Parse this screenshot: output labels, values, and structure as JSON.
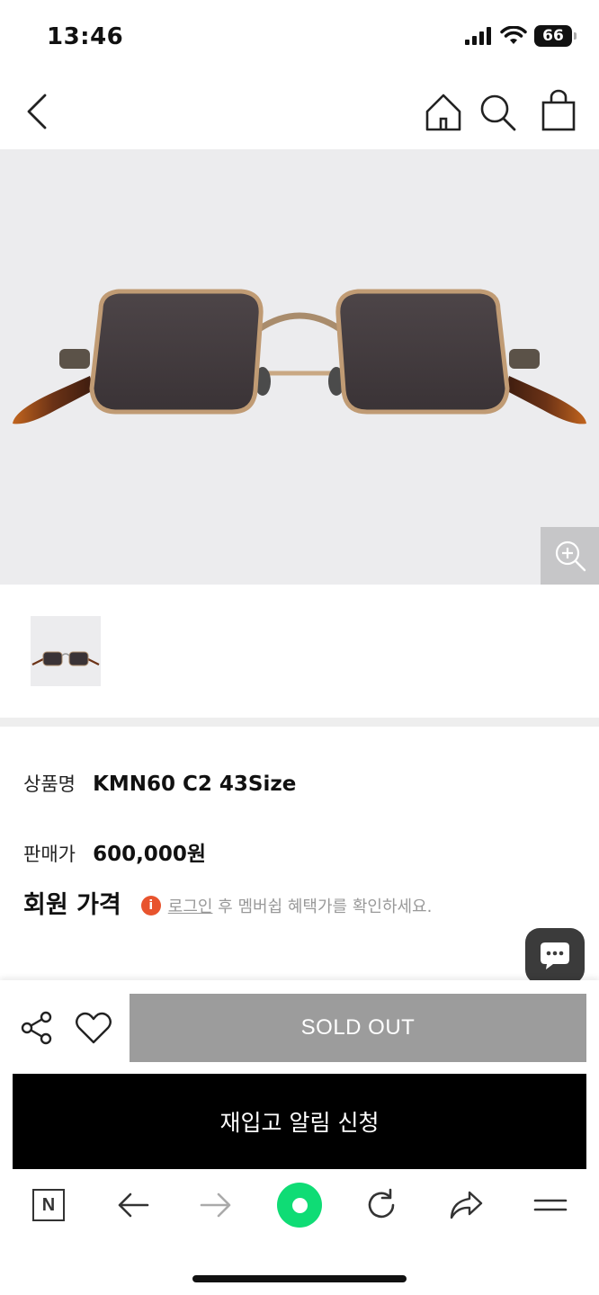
{
  "status_bar": {
    "time": "13:46",
    "battery": "66"
  },
  "product": {
    "name_label": "상품명",
    "name": "KMN60 C2 43Size",
    "price_label": "판매가",
    "price": "600,000원",
    "member_price_label": "회원 가격",
    "member_info_icon": "i",
    "login_link": "로그인",
    "member_note": " 후 멤버쉽 혜택가를 확인하세요."
  },
  "actions": {
    "sold_out_label": "SOLD OUT",
    "restock_label": "재입고 알림 신청"
  },
  "browser_nav": {
    "naver_label": "N"
  },
  "icons": {
    "back": "chevron-left-icon",
    "home": "home-icon",
    "search": "search-icon",
    "cart": "shopping-bag-icon",
    "zoom": "zoom-in-icon",
    "chat": "chat-bubble-icon",
    "share": "share-icon",
    "like": "heart-icon"
  },
  "colors": {
    "sold_out_bg": "#9c9c9c",
    "restock_bg": "#000000",
    "info_icon": "#e8542e",
    "green_button": "#0fdc75",
    "image_bg": "#ececee"
  }
}
